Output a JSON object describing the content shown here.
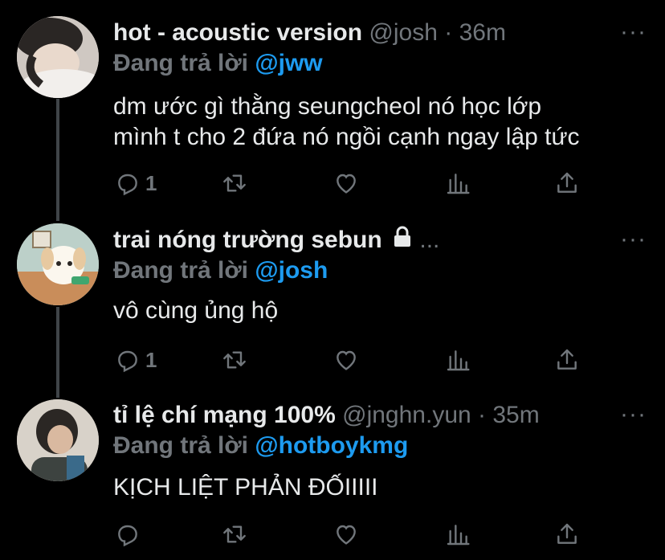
{
  "tweets": [
    {
      "name": "hot - acoustic version",
      "handle": "@josh",
      "separator": "·",
      "time": "36m",
      "reply_prefix": "Đang trả lời",
      "reply_to": "@jww",
      "lines": [
        "dm ước gì thằng seungcheol nó học lớp",
        "mình t cho 2 đứa nó ngồi cạnh ngay lập tức"
      ],
      "reply_count": "1",
      "more": "···"
    },
    {
      "name": "trai nóng trường sebun",
      "handle": "",
      "separator": "...",
      "time": "",
      "reply_prefix": "Đang trả lời",
      "reply_to": "@josh",
      "lines": [
        "vô cùng ủng hộ"
      ],
      "reply_count": "1",
      "more": "···"
    },
    {
      "name": "tỉ lệ chí mạng 100%",
      "handle": "@jnghn.yun",
      "separator": "·",
      "time": "35m",
      "reply_prefix": "Đang trả lời",
      "reply_to": "@hotboykmg",
      "lines": [
        "KỊCH LIỆT PHẢN ĐỐIIIII"
      ],
      "reply_count": "",
      "more": "···"
    }
  ],
  "icons": {
    "reply": "reply-icon",
    "retweet": "retweet-icon",
    "like": "like-icon",
    "analytics": "analytics-icon",
    "share": "share-icon",
    "lock": "lock-icon"
  }
}
